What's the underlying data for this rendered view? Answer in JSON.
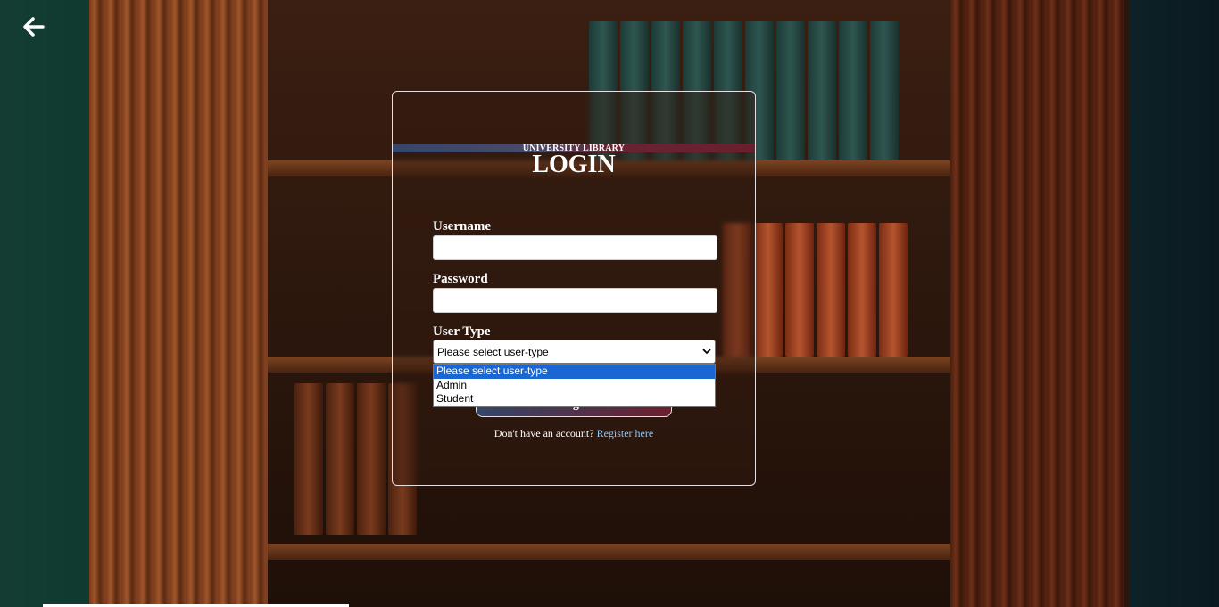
{
  "header": {
    "back_icon": "arrow-left-icon"
  },
  "login": {
    "brand": "UNIVERSITY LIBRARY",
    "title": "LOGIN",
    "username_label": "Username",
    "username_value": "",
    "password_label": "Password",
    "password_value": "",
    "usertype_label": "User Type",
    "usertype_selected": "Please select user-type",
    "usertype_options": [
      "Please select user-type",
      "Admin",
      "Student"
    ],
    "login_button": "Login",
    "register_prompt": "Don't have an account?",
    "register_link": "Register here"
  },
  "colors": {
    "accent_blue": "#34466a",
    "accent_maroon": "#6b1f2e",
    "link": "#8fc8f0",
    "option_highlight": "#1a66d2"
  }
}
